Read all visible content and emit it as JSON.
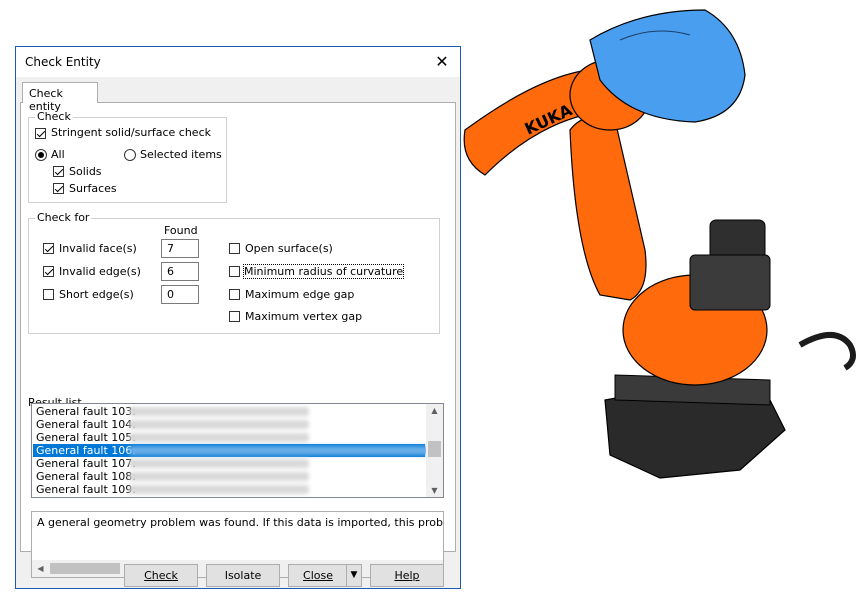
{
  "dialog": {
    "title": "Check Entity",
    "close_glyph": "✕",
    "tab_label": "Check entity",
    "check_group": {
      "label": "Check",
      "stringent_label": "Stringent solid/surface check",
      "stringent_checked": true,
      "all_label": "All",
      "all_selected": true,
      "selected_items_label": "Selected items",
      "solids_label": "Solids",
      "solids_checked": true,
      "surfaces_label": "Surfaces",
      "surfaces_checked": true
    },
    "check_for_group": {
      "label": "Check for",
      "found_header": "Found",
      "invalid_faces_label": "Invalid face(s)",
      "invalid_faces_checked": true,
      "invalid_faces_found": "7",
      "invalid_edges_label": "Invalid edge(s)",
      "invalid_edges_checked": true,
      "invalid_edges_found": "6",
      "short_edges_label": "Short edge(s)",
      "short_edges_checked": false,
      "short_edges_found": "0",
      "open_surfaces_label": "Open surface(s)",
      "min_radius_label": "Minimum radius of curvature",
      "max_edge_gap_label": "Maximum edge gap",
      "max_vertex_gap_label": "Maximum vertex gap"
    },
    "result_list": {
      "label": "Result list",
      "items": [
        "General fault 103:",
        "General fault 104:",
        "General fault 105:",
        "General fault 106:",
        "General fault 107:",
        "General fault 108:",
        "General fault 109:"
      ],
      "selected_index": 3
    },
    "description": "A general geometry problem was found. If this data is imported, this problem",
    "buttons": {
      "check": "Check",
      "isolate": "Isolate",
      "close": "Close",
      "help": "Help"
    }
  },
  "model": {
    "brand_text": "KUKA",
    "colors": {
      "arm": "#ff6a0d",
      "head": "#4a9ef0",
      "base": "#262626"
    }
  }
}
